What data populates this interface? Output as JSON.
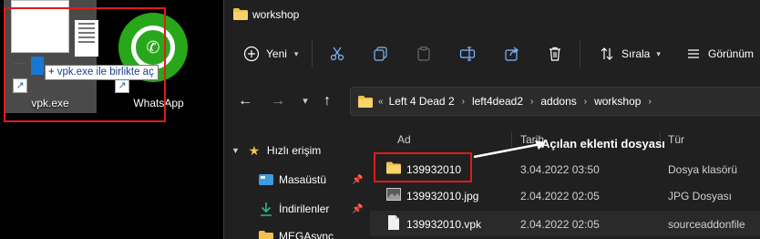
{
  "desktop": {
    "icons": [
      {
        "label": "vpk.exe",
        "icon": "vpk-file-icon"
      },
      {
        "label": "WhatsApp",
        "icon": "whatsapp-icon"
      }
    ],
    "drag_tooltip": "vpk.exe ile birlikte aç"
  },
  "explorer": {
    "title": "workshop",
    "commands": {
      "new_label": "Yeni",
      "sort_label": "Sırala",
      "view_label": "Görünüm"
    },
    "address": {
      "overflow": "«",
      "crumbs": [
        "Left 4 Dead 2",
        "left4dead2",
        "addons",
        "workshop"
      ]
    },
    "sidebar": {
      "quick_access": "Hızlı erişim",
      "items": [
        {
          "label": "Masaüstü",
          "icon": "desktop-folder-icon"
        },
        {
          "label": "İndirilenler",
          "icon": "download-icon"
        },
        {
          "label": "MEGAsync",
          "icon": "folder-icon"
        }
      ]
    },
    "columns": {
      "name": "Ad",
      "date": "Tarih",
      "type": "Tür"
    },
    "files": [
      {
        "name": "139932010",
        "date": "3.04.2022 03:50",
        "type": "Dosya klasörü",
        "icon": "folder-icon"
      },
      {
        "name": "139932010.jpg",
        "date": "2.04.2022 02:05",
        "type": "JPG Dosyası",
        "icon": "image-file-icon"
      },
      {
        "name": "139932010.vpk",
        "date": "2.04.2022 02:05",
        "type": "sourceaddonfile",
        "icon": "file-icon"
      }
    ]
  },
  "annotation": {
    "text": "Açılan eklenti dosyası"
  },
  "colors": {
    "highlight_box": "#e01b1b",
    "folder": "#f2c14e",
    "whatsapp": "#29a71a"
  }
}
